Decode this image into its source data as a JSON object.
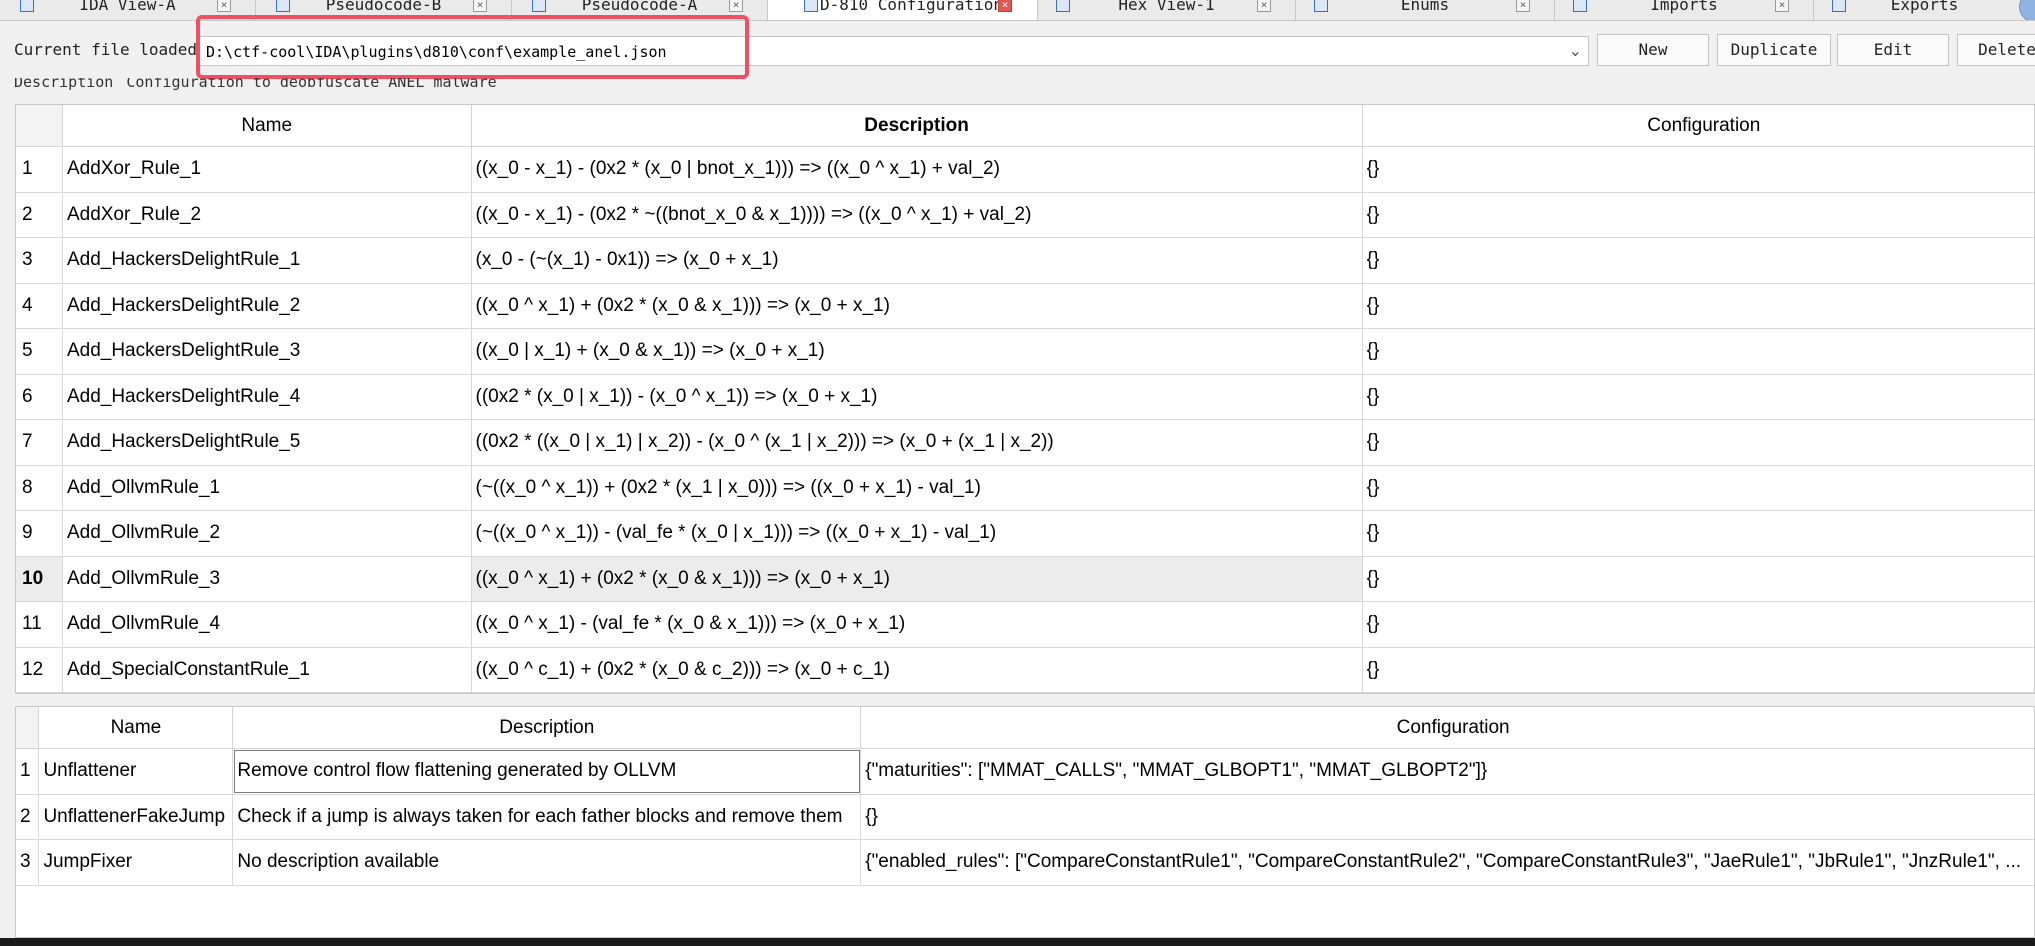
{
  "tabs": [
    {
      "label": "IDA View-A",
      "active": false
    },
    {
      "label": "Pseudocode-B",
      "active": false
    },
    {
      "label": "Pseudocode-A",
      "active": false
    },
    {
      "label": "D-810 Configuration",
      "active": true
    },
    {
      "label": "Hex View-1",
      "active": false
    },
    {
      "label": "Enums",
      "active": false
    },
    {
      "label": "Imports",
      "active": false
    },
    {
      "label": "Exports",
      "active": false
    }
  ],
  "file": {
    "label": "Current file loaded:",
    "value": "D:\\ctf-cool\\IDA\\plugins\\d810\\conf\\example_anel.json"
  },
  "buttons": {
    "new": "New",
    "duplicate": "Duplicate",
    "edit": "Edit",
    "delete": "Delete"
  },
  "description": {
    "label": "Description",
    "value": "Configuration to deobfuscate ANEL malware"
  },
  "rules_table": {
    "headers": [
      "Name",
      "Description",
      "Configuration"
    ],
    "rows": [
      {
        "n": "1",
        "name": "AddXor_Rule_1",
        "desc": "((x_0 - x_1) - (0x2 * (x_0 | bnot_x_1))) => ((x_0 ^ x_1) + val_2)",
        "conf": "{}"
      },
      {
        "n": "2",
        "name": "AddXor_Rule_2",
        "desc": "((x_0 - x_1) - (0x2 * ~((bnot_x_0 & x_1)))) => ((x_0 ^ x_1) + val_2)",
        "conf": "{}"
      },
      {
        "n": "3",
        "name": "Add_HackersDelightRule_1",
        "desc": "(x_0 - (~(x_1) - 0x1)) => (x_0 + x_1)",
        "conf": "{}"
      },
      {
        "n": "4",
        "name": "Add_HackersDelightRule_2",
        "desc": "((x_0 ^ x_1) + (0x2 * (x_0 & x_1))) => (x_0 + x_1)",
        "conf": "{}"
      },
      {
        "n": "5",
        "name": "Add_HackersDelightRule_3",
        "desc": "((x_0 | x_1) + (x_0 & x_1)) => (x_0 + x_1)",
        "conf": "{}"
      },
      {
        "n": "6",
        "name": "Add_HackersDelightRule_4",
        "desc": "((0x2 * (x_0 | x_1)) - (x_0 ^ x_1)) => (x_0 + x_1)",
        "conf": "{}"
      },
      {
        "n": "7",
        "name": "Add_HackersDelightRule_5",
        "desc": "((0x2 * ((x_0 | x_1) | x_2)) - (x_0 ^ (x_1 | x_2))) => (x_0 + (x_1 | x_2))",
        "conf": "{}"
      },
      {
        "n": "8",
        "name": "Add_OllvmRule_1",
        "desc": "(~((x_0 ^ x_1)) + (0x2 * (x_1 | x_0))) => ((x_0 + x_1) - val_1)",
        "conf": "{}"
      },
      {
        "n": "9",
        "name": "Add_OllvmRule_2",
        "desc": "(~((x_0 ^ x_1)) - (val_fe * (x_0 | x_1))) => ((x_0 + x_1) - val_1)",
        "conf": "{}"
      },
      {
        "n": "10",
        "name": "Add_OllvmRule_3",
        "desc": "((x_0 ^ x_1) + (0x2 * (x_0 & x_1))) => (x_0 + x_1)",
        "conf": "{}"
      },
      {
        "n": "11",
        "name": "Add_OllvmRule_4",
        "desc": "((x_0 ^ x_1) - (val_fe * (x_0 & x_1))) => (x_0 + x_1)",
        "conf": "{}"
      },
      {
        "n": "12",
        "name": "Add_SpecialConstantRule_1",
        "desc": "((x_0 ^ c_1) + (0x2 * (x_0 & c_2))) => (x_0 + c_1)",
        "conf": "{}"
      }
    ],
    "selected_row": "10"
  },
  "blocks_table": {
    "headers": [
      "Name",
      "Description",
      "Configuration"
    ],
    "rows": [
      {
        "n": "1",
        "name": "Unflattener",
        "desc": "Remove control flow flattening generated by OLLVM",
        "conf": "{\"maturities\": [\"MMAT_CALLS\", \"MMAT_GLBOPT1\", \"MMAT_GLBOPT2\"]}"
      },
      {
        "n": "2",
        "name": "UnflattenerFakeJump",
        "desc": "Check if a jump is always taken for each father blocks and remove them",
        "conf": "{}"
      },
      {
        "n": "3",
        "name": "JumpFixer",
        "desc": "No description available",
        "conf": "{\"enabled_rules\": [\"CompareConstantRule1\", \"CompareConstantRule2\", \"CompareConstantRule3\", \"JaeRule1\", \"JbRule1\", \"JnzRule1\", ..."
      }
    ]
  }
}
